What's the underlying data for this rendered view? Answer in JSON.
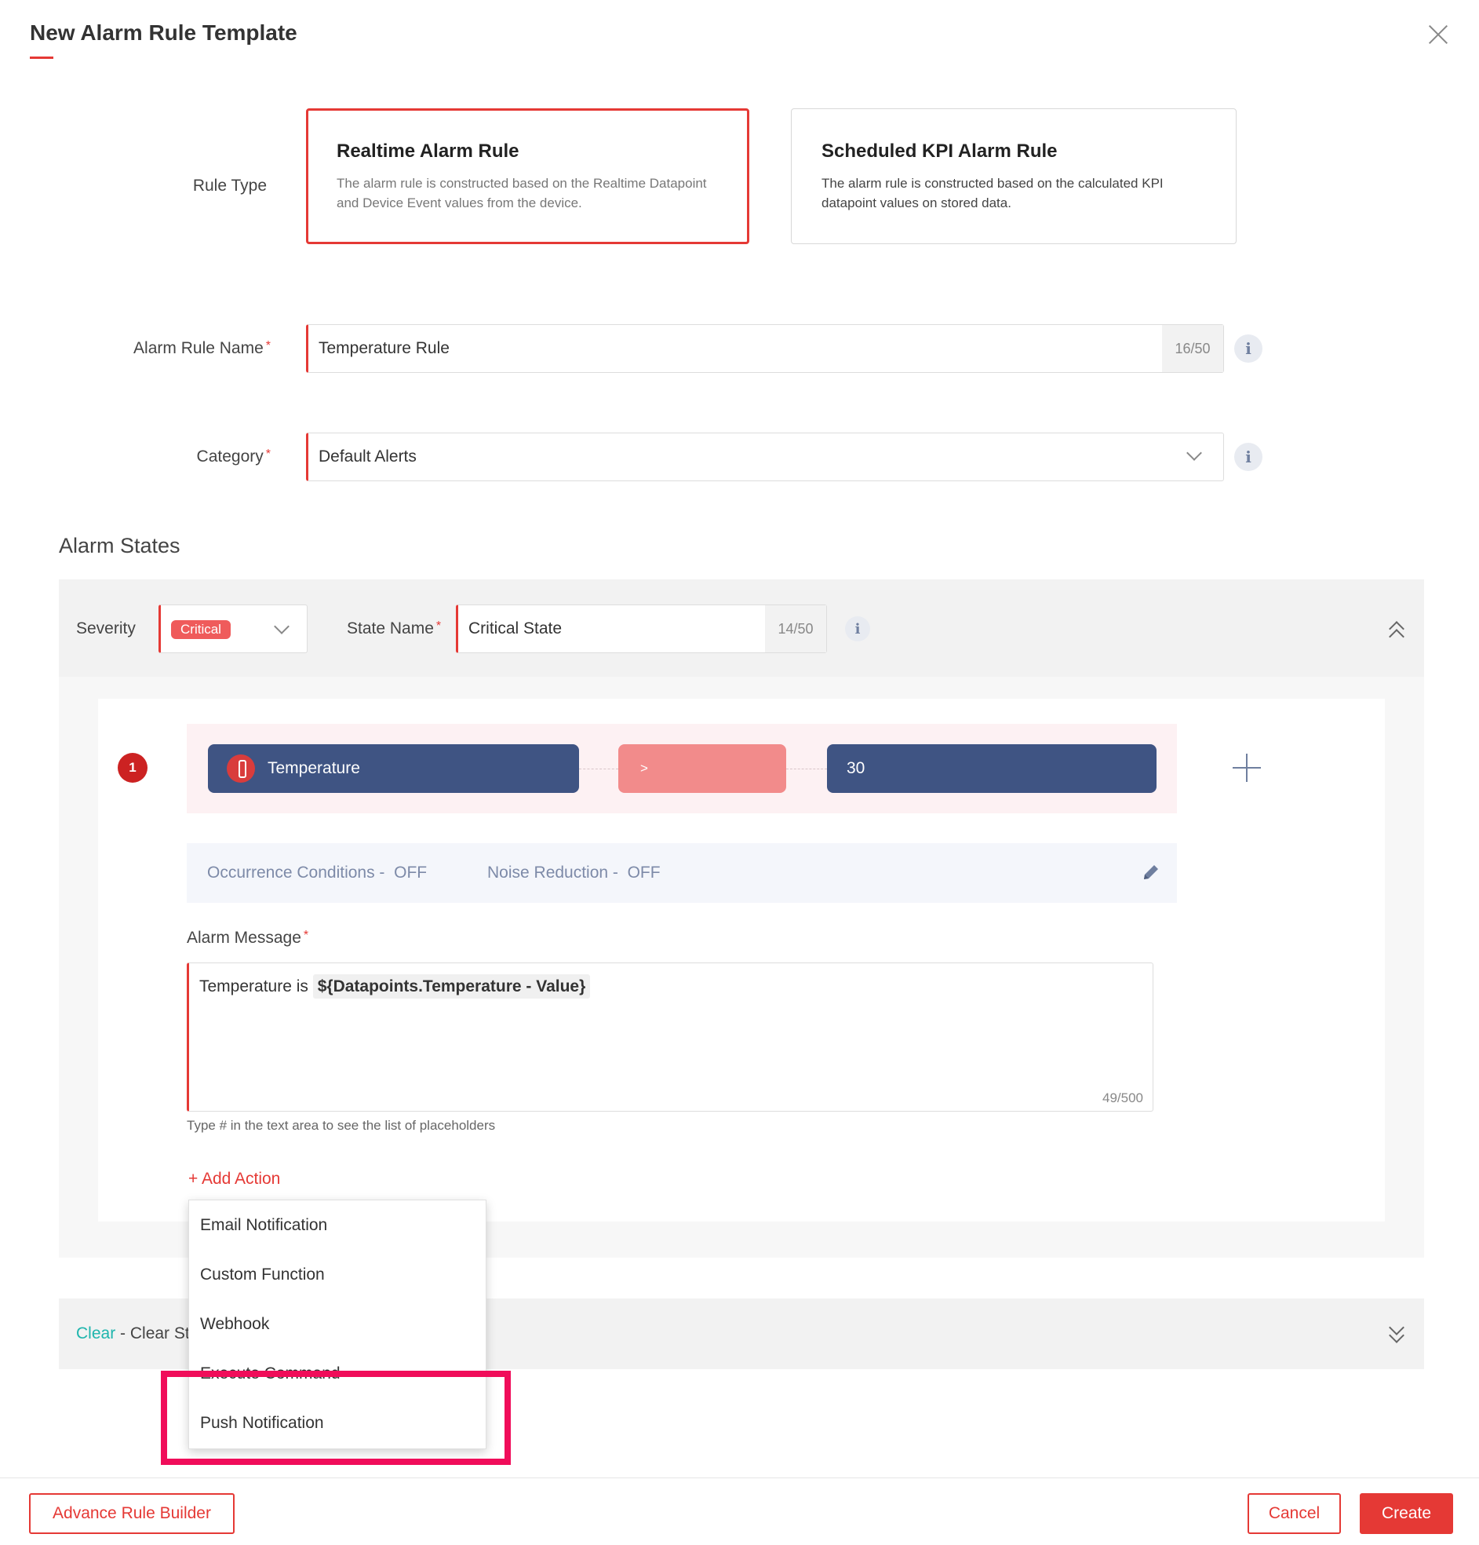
{
  "dialog": {
    "title": "New Alarm Rule Template"
  },
  "rule_type": {
    "label": "Rule Type",
    "options": [
      {
        "title": "Realtime Alarm Rule",
        "description": "The alarm rule is constructed based on the Realtime Datapoint and Device Event values from the device.",
        "selected": true
      },
      {
        "title": "Scheduled KPI Alarm Rule",
        "description": "The alarm rule is constructed based on the calculated KPI datapoint values on stored data.",
        "selected": false
      }
    ]
  },
  "alarm_rule_name": {
    "label": "Alarm Rule Name",
    "value": "Temperature Rule",
    "counter": "16/50"
  },
  "category": {
    "label": "Category",
    "value": "Default Alerts"
  },
  "alarm_states": {
    "title": "Alarm States",
    "severity_label": "Severity",
    "severity_value": "Critical",
    "state_name_label": "State Name",
    "state_name_value": "Critical State",
    "state_name_counter": "14/50",
    "condition": {
      "index": "1",
      "datapoint": "Temperature",
      "operator": ">",
      "value": "30"
    },
    "occurrence_label": "Occurrence Conditions -",
    "occurrence_value": "OFF",
    "noise_label": "Noise Reduction -",
    "noise_value": "OFF",
    "alarm_message_label": "Alarm Message",
    "alarm_message_text": "Temperature is",
    "alarm_message_placeholder": "${Datapoints.Temperature - Value}",
    "alarm_message_counter": "49/500",
    "hint": "Type # in the text area to see the list of placeholders",
    "add_action": "+ Add Action",
    "action_menu": [
      "Email Notification",
      "Custom Function",
      "Webhook",
      "Execute Command",
      "Push Notification"
    ]
  },
  "clear_state": {
    "label": "Clear",
    "separator": "- Clear St"
  },
  "footer": {
    "advance": "Advance Rule Builder",
    "cancel": "Cancel",
    "create": "Create"
  },
  "colors": {
    "accent": "#e53935",
    "pill": "#3f5483",
    "highlight": "#f00d5a"
  }
}
